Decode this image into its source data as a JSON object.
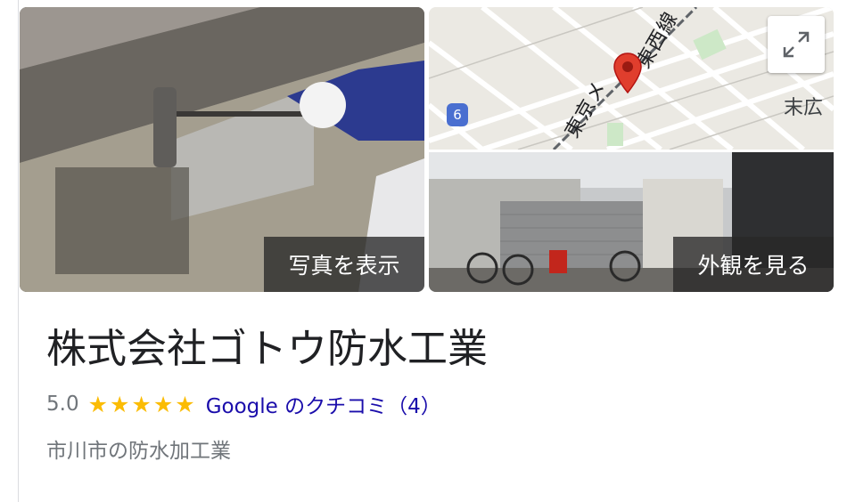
{
  "photos": {
    "show_photos_label": "写真を表示"
  },
  "map": {
    "area_label": "末広",
    "route_badge": "6",
    "line_label_1": "東京メ",
    "line_label_2": "東西線",
    "pin_color": "#e03e2d"
  },
  "street_view": {
    "label": "外観を見る"
  },
  "business": {
    "name": "株式会社ゴトウ防水工業",
    "rating": "5.0",
    "stars": 5,
    "reviews_link": "Google のクチコミ（4）",
    "category": "市川市の防水加工業"
  },
  "colors": {
    "star": "#fbbc04",
    "link": "#1a0dab",
    "meta_text": "#70757a"
  }
}
